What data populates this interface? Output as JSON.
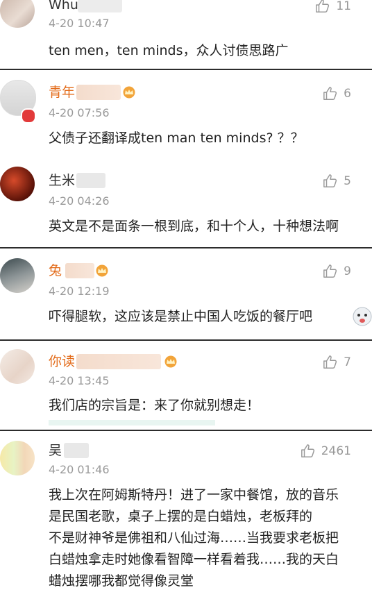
{
  "comments": [
    {
      "user": "Whu",
      "time": "4-20 10:47",
      "likes": "11",
      "lines": [
        "ten men，ten minds，众人讨债思路广"
      ],
      "user_color": "#333333"
    },
    {
      "user": "青年",
      "time": "4-20 07:56",
      "likes": "6",
      "lines": [
        "父债子还翻译成ten man ten minds? ？？"
      ],
      "user_color": "#e36c1b"
    },
    {
      "user": "生米",
      "time": "4-20 04:26",
      "likes": "5",
      "lines": [
        "英文是不是面条一根到底，和十个人，十种想法啊"
      ],
      "user_color": "#333333"
    },
    {
      "user": "兔",
      "time": "4-20 12:19",
      "likes": "9",
      "lines": [
        "吓得腿软，这应该是禁止中国人吃饭的餐厅吧"
      ],
      "user_color": "#e36c1b"
    },
    {
      "user": "你读",
      "time": "4-20 13:45",
      "likes": "7",
      "lines": [
        "我们店的宗旨是：来了你就别想走！"
      ],
      "user_color": "#e36c1b"
    },
    {
      "user": "吴",
      "time": "4-20 01:46",
      "likes": "2461",
      "lines": [
        "我上次在阿姆斯特丹！进了一家中餐馆，放的音乐",
        "是民国老歌，桌子上摆的是白蜡烛，老板拜的",
        "不是财神爷是佛祖和八仙过海……当我要求老板把",
        "白蜡烛拿走时她像看智障一样看着我……我的天白",
        "蜡烛摆哪我都觉得像灵堂"
      ],
      "user_color": "#333333"
    }
  ],
  "icons": {
    "like": "thumbs-up-icon",
    "crown": "crown-icon",
    "emoji": "dog-emoji-icon",
    "candle": "candle-icon",
    "vip": "vip-badge-icon"
  },
  "colors": {
    "accent": "#e36c1b",
    "muted": "#999999",
    "divider": "#2c2c2c"
  }
}
